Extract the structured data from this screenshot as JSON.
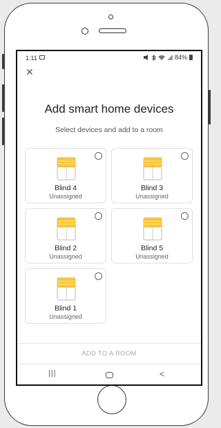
{
  "status_bar": {
    "time": "1:11",
    "battery_percent": "84%",
    "icons": [
      "image-icon",
      "mute-icon",
      "bluetooth-icon",
      "wifi-icon",
      "signal-icon",
      "battery-icon"
    ]
  },
  "header": {
    "close_icon": "✕",
    "title": "Add smart home devices",
    "subtitle": "Select devices and add to a room"
  },
  "devices": [
    {
      "name": "Blind 4",
      "room": "Unassigned",
      "selected": false
    },
    {
      "name": "Blind 3",
      "room": "Unassigned",
      "selected": false
    },
    {
      "name": "Blind 2",
      "room": "Unassigned",
      "selected": false
    },
    {
      "name": "Blind 5",
      "room": "Unassigned",
      "selected": false
    },
    {
      "name": "Blind 1",
      "room": "Unassigned",
      "selected": false
    }
  ],
  "footer": {
    "add_to_room_label": "ADD TO A ROOM"
  },
  "nav": {
    "recent_glyph": "|||",
    "back_glyph": "<"
  },
  "colors": {
    "blind_yellow": "#f9c53a",
    "blind_light": "#fde9a8",
    "card_border": "#e0e0e0",
    "disabled_text": "#aaaaaa"
  }
}
